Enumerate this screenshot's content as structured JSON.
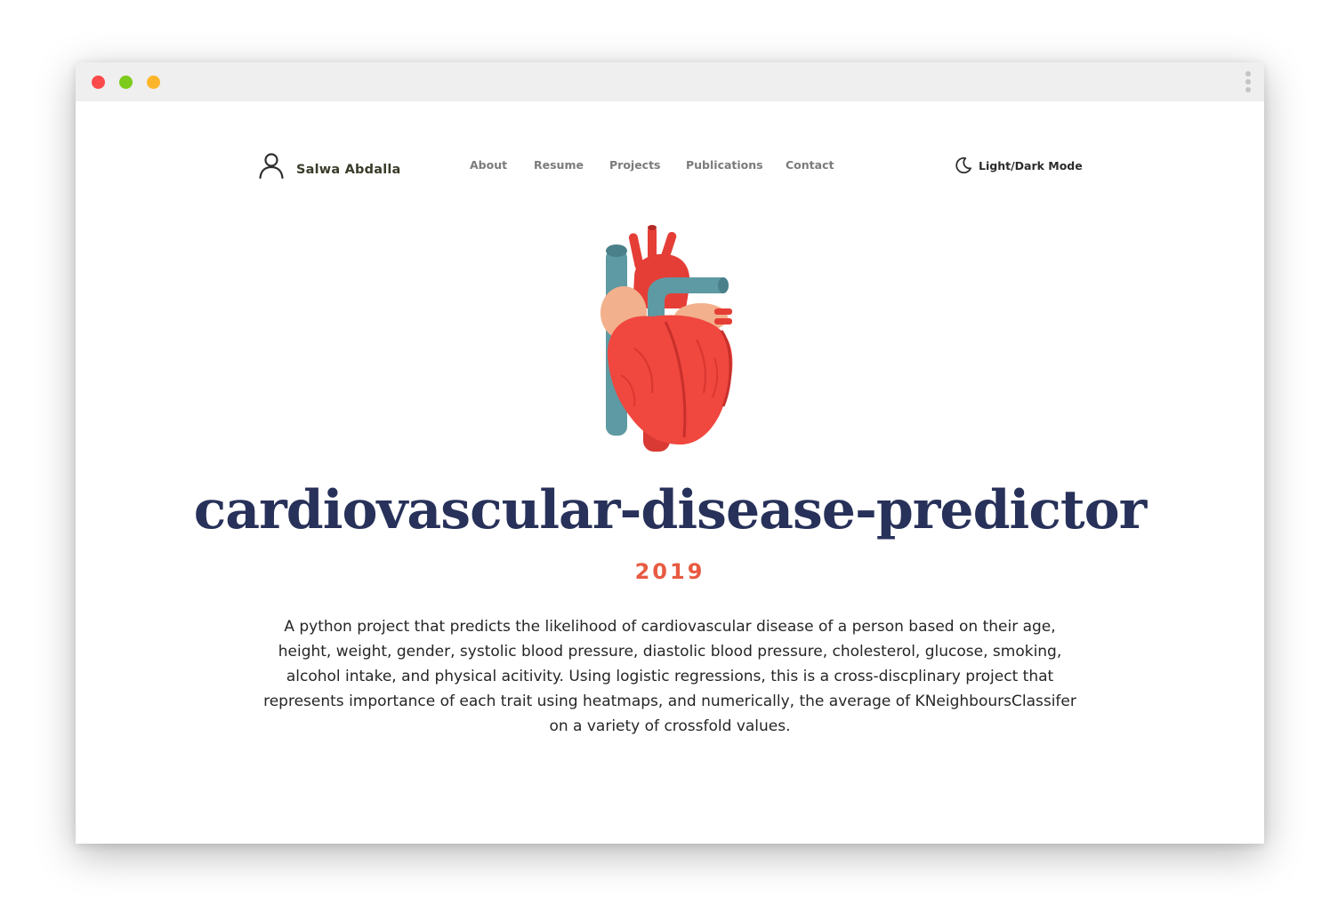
{
  "window": {
    "controls": [
      "close",
      "minimize",
      "zoom"
    ]
  },
  "brand": {
    "name": "Salwa Abdalla",
    "icon": "user-icon"
  },
  "nav": {
    "items": [
      {
        "label": "About"
      },
      {
        "label": "Resume"
      },
      {
        "label": "Projects"
      },
      {
        "label": "Publications"
      },
      {
        "label": "Contact"
      }
    ]
  },
  "theme_toggle": {
    "label": "Light/Dark Mode",
    "icon": "moon-icon"
  },
  "project": {
    "image_icon": "heart-illustration",
    "title": "cardiovascular-disease-predictor",
    "year": "2019",
    "description": "A python project that predicts the likelihood of cardiovascular disease of a person based on their age, height, weight, gender, systolic blood pressure, diastolic blood pressure, cholesterol, glucose, smoking, alcohol intake, and physical acitivity. Using logistic regressions, this is a cross-discplinary project that represents importance of each trait using heatmaps, and numerically, the average of KNeighboursClassifer on a variety of crossfold values."
  },
  "colors": {
    "title": "#273159",
    "year": "#e85a42",
    "heart_red": "#f0473f",
    "vessel_teal": "#5e9aa3"
  }
}
